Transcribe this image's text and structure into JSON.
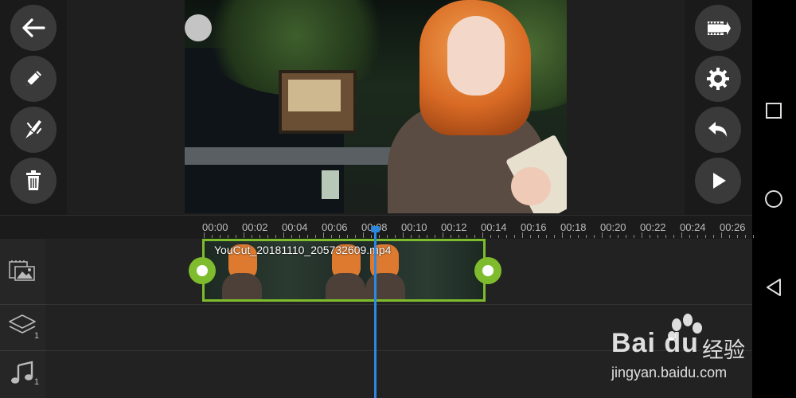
{
  "toolbar_left": {
    "buttons": [
      {
        "name": "back",
        "icon": "arrow-left-icon"
      },
      {
        "name": "edit",
        "icon": "pencil-icon"
      },
      {
        "name": "effects",
        "icon": "magic-wand-icon"
      },
      {
        "name": "delete",
        "icon": "trash-icon"
      }
    ]
  },
  "toolbar_right": {
    "buttons": [
      {
        "name": "export",
        "icon": "film-export-icon"
      },
      {
        "name": "settings",
        "icon": "gear-icon"
      },
      {
        "name": "undo",
        "icon": "undo-icon"
      },
      {
        "name": "play",
        "icon": "play-icon"
      }
    ]
  },
  "timeline": {
    "ruler_labels": [
      "00:00",
      "00:02",
      "00:04",
      "00:06",
      "00:08",
      "00:10",
      "00:12",
      "00:14",
      "00:16",
      "00:18",
      "00:20",
      "00:22",
      "00:24",
      "00:26"
    ],
    "clip": {
      "filename": "YouCut_20181110_205732609.mp4",
      "border_color": "#7fbc2d"
    },
    "playhead_color": "#2d88e0",
    "tracks": [
      {
        "name": "video-track",
        "icon": "video-clip-icon",
        "count": ""
      },
      {
        "name": "overlay-track",
        "icon": "layers-icon",
        "count": "1"
      },
      {
        "name": "audio-track",
        "icon": "music-note-icon",
        "count": "1"
      }
    ]
  },
  "system_nav": {
    "buttons": [
      {
        "name": "recent-apps",
        "icon": "square-icon"
      },
      {
        "name": "home",
        "icon": "circle-icon"
      },
      {
        "name": "back",
        "icon": "triangle-back-icon"
      }
    ]
  },
  "watermark": {
    "logo": "Bai du",
    "logo_cn": "经验",
    "url": "jingyan.baidu.com"
  }
}
